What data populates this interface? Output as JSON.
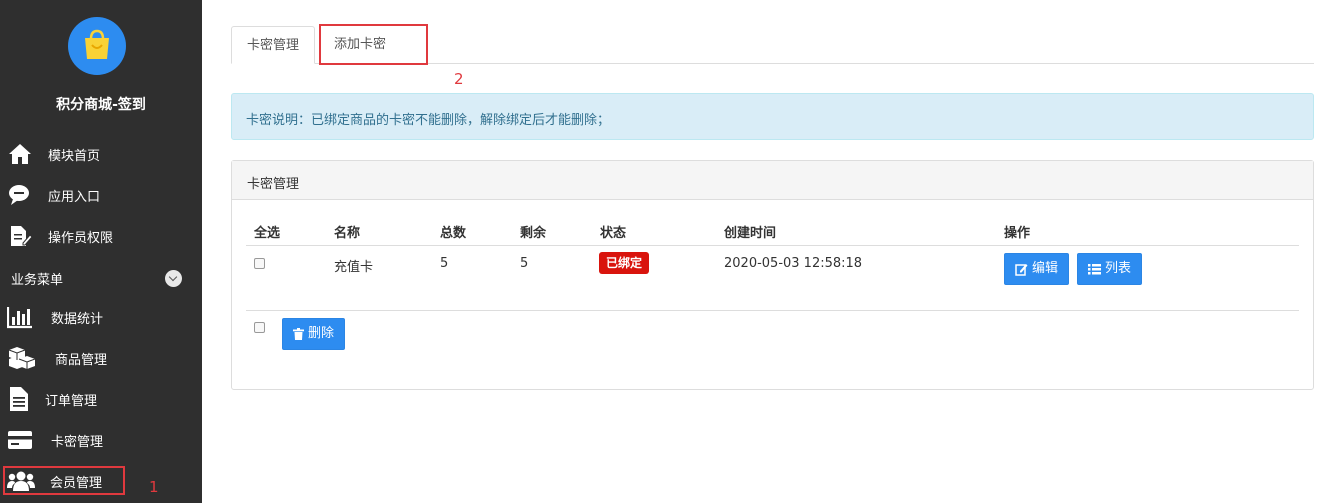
{
  "sidebar": {
    "app_title": "积分商城-签到",
    "items": [
      {
        "label": "模块首页",
        "icon": "home-icon"
      },
      {
        "label": "应用入口",
        "icon": "chat-bubble-icon"
      },
      {
        "label": "操作员权限",
        "icon": "edit-document-icon"
      }
    ],
    "section_title": "业务菜单",
    "menu": [
      {
        "label": "数据统计",
        "icon": "bar-chart-icon"
      },
      {
        "label": "商品管理",
        "icon": "cubes-icon"
      },
      {
        "label": "订单管理",
        "icon": "document-icon"
      },
      {
        "label": "卡密管理",
        "icon": "credit-card-icon"
      },
      {
        "label": "会员管理",
        "icon": "users-icon"
      }
    ]
  },
  "annotations": {
    "one": "1",
    "two": "2"
  },
  "tabs": [
    {
      "label": "卡密管理",
      "active": true
    },
    {
      "label": "添加卡密",
      "active": false
    }
  ],
  "info_text": "卡密说明：已绑定商品的卡密不能删除，解除绑定后才能删除；",
  "panel": {
    "title": "卡密管理",
    "columns": [
      "全选",
      "名称",
      "总数",
      "剩余",
      "状态",
      "创建时间",
      "操作"
    ],
    "rows": [
      {
        "name": "充值卡",
        "total": "5",
        "remaining": "5",
        "status": "已绑定",
        "created": "2020-05-03 12:58:18",
        "edit_label": "编辑",
        "list_label": "列表"
      }
    ],
    "delete_label": "删除"
  },
  "colors": {
    "primary": "#2d8cf0",
    "danger": "#d9140d",
    "highlight": "#e0393e",
    "sidebar": "#2f2f2f"
  }
}
